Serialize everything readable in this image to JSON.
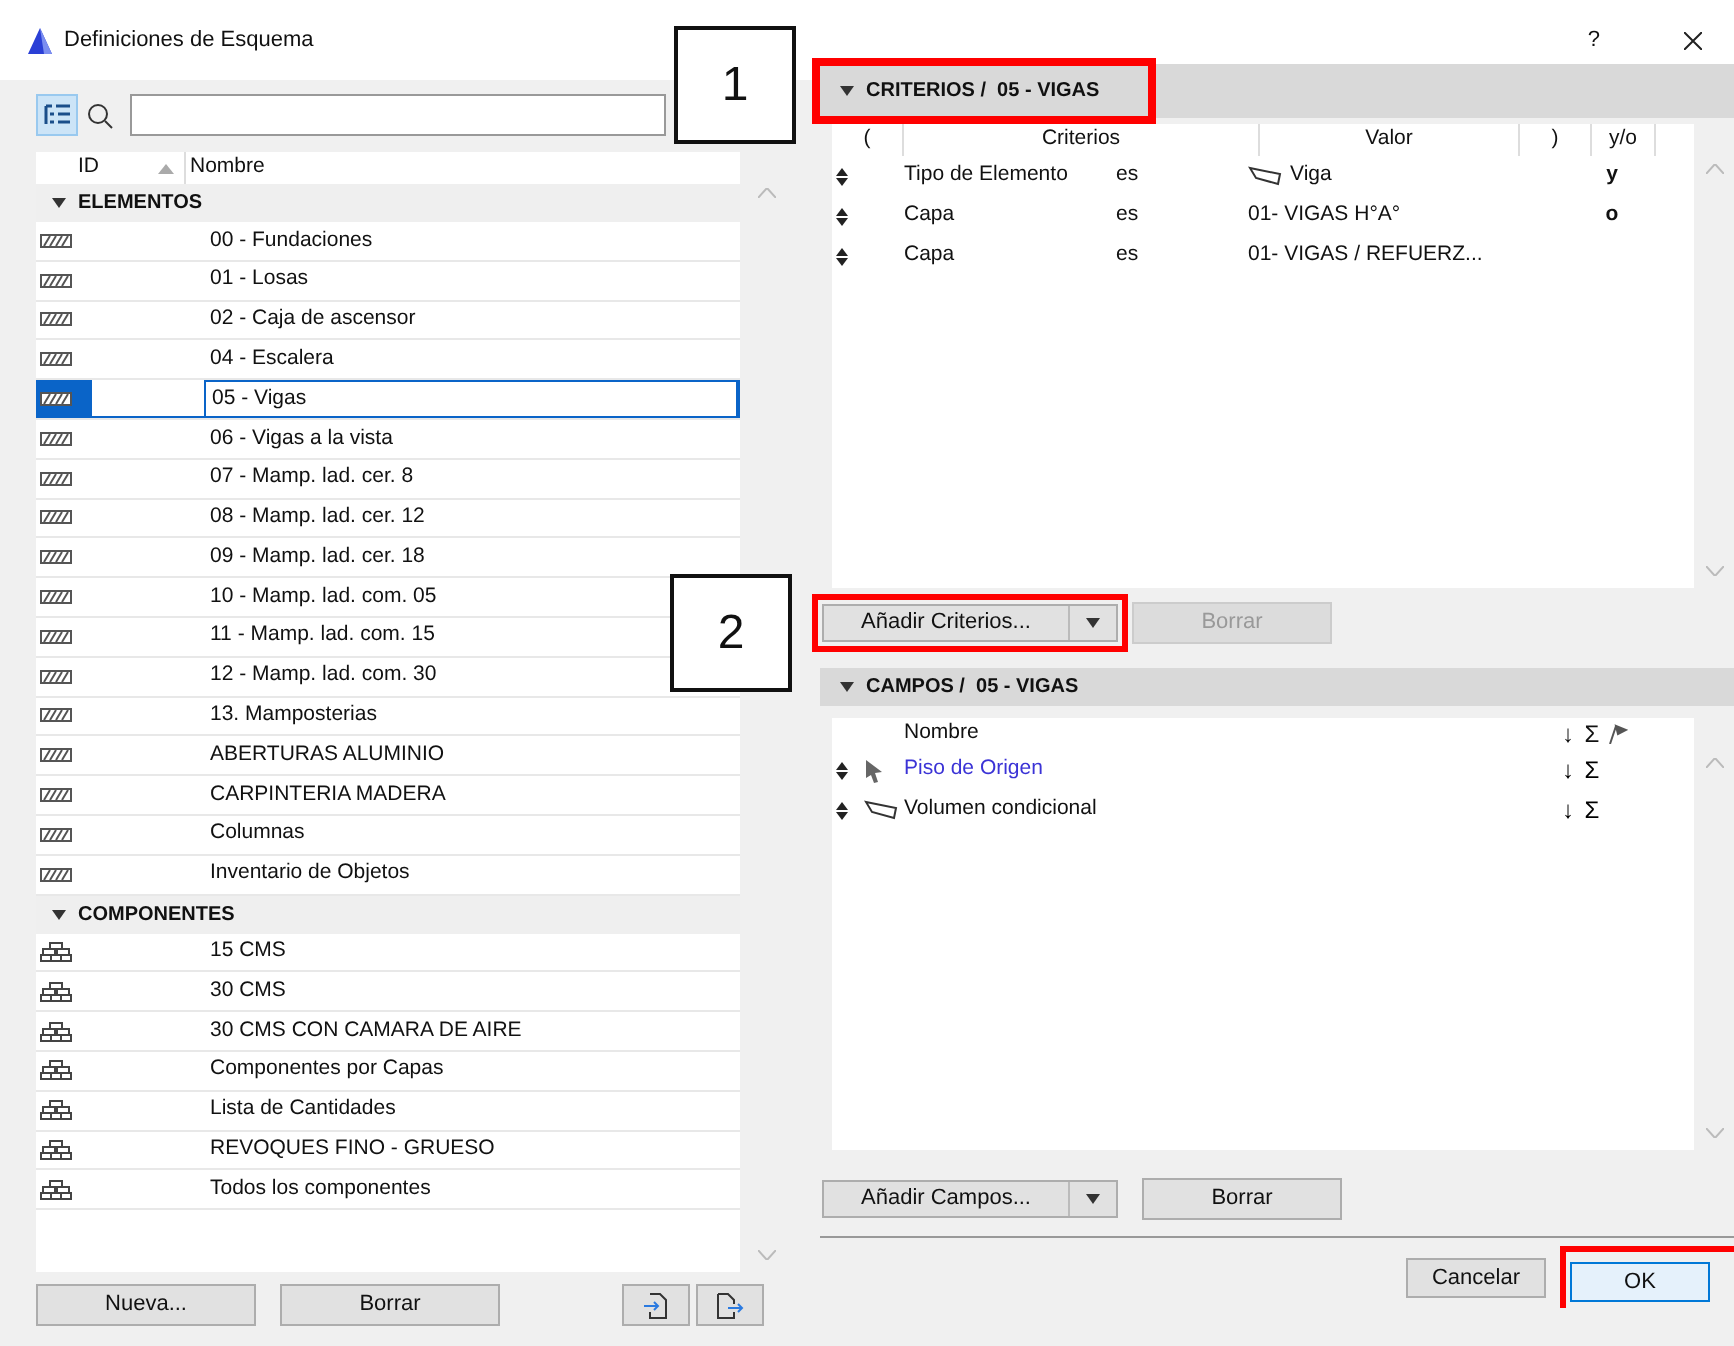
{
  "window": {
    "title": "Definiciones de Esquema",
    "help": "?"
  },
  "schemes": {
    "columns": [
      "ID",
      "Nombre"
    ],
    "groups": [
      {
        "label": "ELEMENTOS",
        "expanded": true,
        "kind": "element",
        "items": [
          {
            "name": "00 - Fundaciones",
            "selected": false
          },
          {
            "name": "01 - Losas",
            "selected": false
          },
          {
            "name": "02 - Caja de ascensor",
            "selected": false
          },
          {
            "name": "04 - Escalera",
            "selected": false
          },
          {
            "name": "05 - Vigas",
            "selected": true
          },
          {
            "name": "06 - Vigas a la vista",
            "selected": false
          },
          {
            "name": "07 - Mamp. lad. cer. 8",
            "selected": false
          },
          {
            "name": "08 - Mamp. lad. cer. 12",
            "selected": false
          },
          {
            "name": "09 - Mamp. lad. cer. 18",
            "selected": false
          },
          {
            "name": "10 - Mamp. lad. com. 05",
            "selected": false
          },
          {
            "name": "11 - Mamp. lad. com. 15",
            "selected": false
          },
          {
            "name": "12 - Mamp. lad. com. 30",
            "selected": false
          },
          {
            "name": "13. Mamposterias",
            "selected": false
          },
          {
            "name": "ABERTURAS ALUMINIO",
            "selected": false
          },
          {
            "name": "CARPINTERIA MADERA",
            "selected": false
          },
          {
            "name": "Columnas",
            "selected": false
          },
          {
            "name": "Inventario de Objetos",
            "selected": false
          }
        ]
      },
      {
        "label": "COMPONENTES",
        "expanded": true,
        "kind": "component",
        "items": [
          {
            "name": "15 CMS",
            "selected": false
          },
          {
            "name": "30 CMS",
            "selected": false
          },
          {
            "name": "30 CMS  CON CAMARA DE AIRE",
            "selected": false
          },
          {
            "name": "Componentes por Capas",
            "selected": false
          },
          {
            "name": "Lista de Cantidades",
            "selected": false
          },
          {
            "name": "REVOQUES FINO - GRUESO",
            "selected": false
          },
          {
            "name": "Todos los componentes",
            "selected": false
          }
        ]
      }
    ]
  },
  "left_buttons": [
    "Nueva...",
    "Borrar"
  ],
  "criteria": {
    "title": "CRITERIOS /  05 - VIGAS",
    "expanded": true,
    "highlighted": true,
    "columns": [
      "(",
      "Criterios",
      "Valor",
      ")",
      "y/o"
    ],
    "rows": [
      {
        "criterion": "Tipo de Elemento",
        "operator": "es",
        "value": "Viga",
        "kind": "beam",
        "conjunction": "y"
      },
      {
        "criterion": "Capa",
        "operator": "es",
        "value": "01- VIGAS H°A°",
        "kind": "text",
        "conjunction": "o"
      },
      {
        "criterion": "Capa",
        "operator": "es",
        "value": "01- VIGAS / REFUERZ...",
        "kind": "text",
        "conjunction": ""
      }
    ],
    "add_button": {
      "label": "Añadir Criterios...",
      "highlighted": true
    },
    "delete_button": {
      "label": "Borrar",
      "disabled": true
    }
  },
  "fields": {
    "title": "CAMPOS /  05 - VIGAS",
    "expanded": true,
    "columns": [
      "Nombre",
      "↓",
      "Σ"
    ],
    "rows": [
      {
        "name": "Piso de Origen",
        "kind": "pointer",
        "linked": true,
        "sort": "↓",
        "sum": "Σ"
      },
      {
        "name": "Volumen condicional",
        "kind": "beam",
        "linked": false,
        "sort": "↓",
        "sum": "Σ"
      }
    ],
    "add_button": {
      "label": "Añadir Campos...",
      "highlighted": false
    },
    "delete_button": {
      "label": "Borrar",
      "disabled": false
    }
  },
  "footer_buttons": [
    {
      "label": "Cancelar",
      "default": false,
      "highlighted": false
    },
    {
      "label": "OK",
      "default": true,
      "highlighted": true
    }
  ],
  "callouts": [
    {
      "label": "1"
    },
    {
      "label": "2"
    }
  ]
}
